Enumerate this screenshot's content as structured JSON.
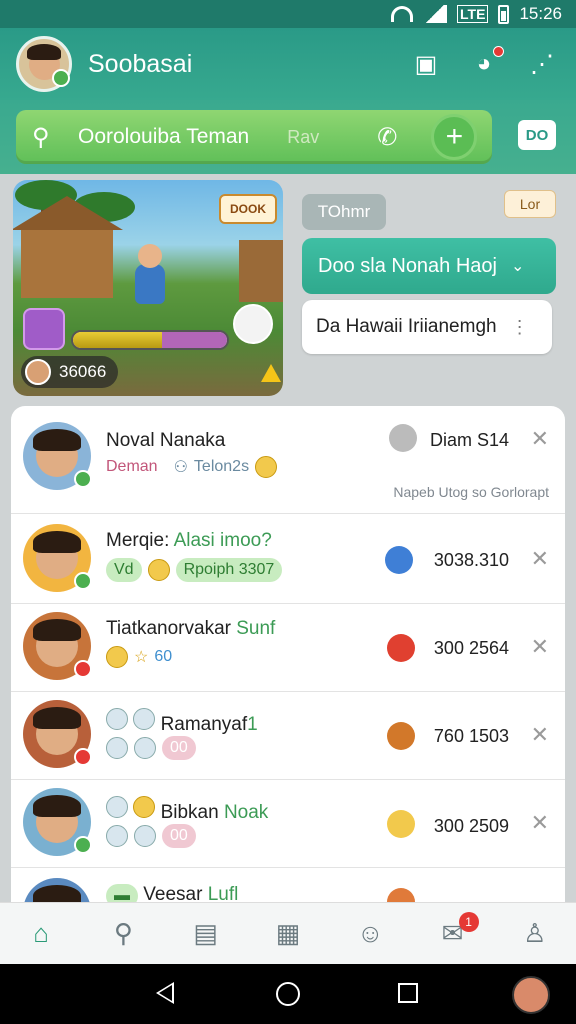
{
  "status_bar": {
    "time": "15:26",
    "network": "LTE"
  },
  "header": {
    "title": "Soobasai"
  },
  "search": {
    "text": "Oorolouiba Teman",
    "mid_text": "Rav",
    "add_icon": "+",
    "chat_button": "DO"
  },
  "game_card": {
    "sign": "DOOK",
    "score": "36066",
    "progress": 0.58
  },
  "chat": {
    "label_gray": "TOhmr",
    "label_chip": "Lor",
    "bubble_green": "Doo sla Nonah Haoj",
    "bubble_white": "Da Hawaii Iriianemgh"
  },
  "list": {
    "rows": [
      {
        "name": "Noval Nanaka",
        "name_hl": "",
        "sub1": "Deman",
        "sub2": "Telon2s",
        "amount": "Diam S14",
        "footer": "Napeb Utog so Gorlorapt",
        "badge": "green"
      },
      {
        "name": "Merqie: ",
        "name_hl": "Alasi imoo?",
        "pill1": "Vd",
        "pill2": "Rpoiph 3307",
        "amount": "3038.310",
        "badge": "green"
      },
      {
        "name": "Tiatkanorvakar ",
        "name_hl": "Sunf",
        "sub1": "60",
        "amount": "300 2564",
        "badge": "red"
      },
      {
        "name": "Ramanyaf",
        "name_hl": "1",
        "pill1": "00",
        "amount": "760 1503",
        "badge": "red"
      },
      {
        "name": "Bibkan ",
        "name_hl": "Noak",
        "pill1": "00",
        "amount": "300 2509",
        "badge": "green"
      },
      {
        "name": "Veesar ",
        "name_hl": "Lufl",
        "badge": "green"
      }
    ]
  },
  "bottom_nav": {
    "badge": "1"
  },
  "colors": {
    "primary": "#2a9a87",
    "accent_green": "#5fbf58",
    "badge_red": "#e53935"
  }
}
